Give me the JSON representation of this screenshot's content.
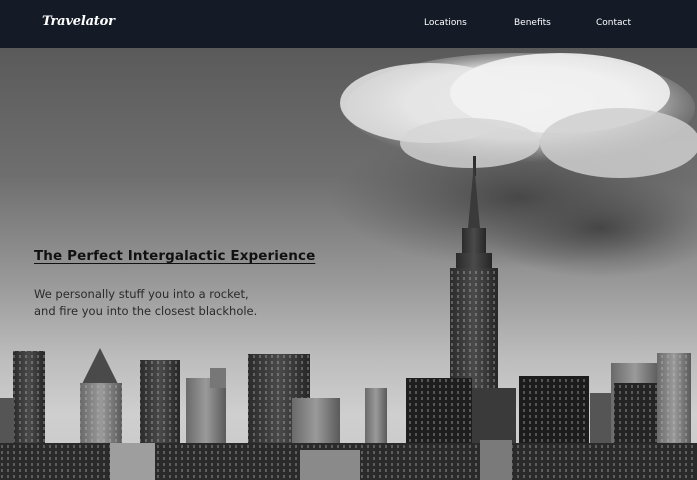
{
  "brand": {
    "logo": "Travelator"
  },
  "nav": {
    "items": [
      {
        "label": "Locations"
      },
      {
        "label": "Benefits"
      },
      {
        "label": "Contact"
      }
    ]
  },
  "hero": {
    "title": "The Perfect Intergalactic Experience",
    "subtitle_line1": "We personally stuff you into a rocket,",
    "subtitle_line2": "and fire you into the closest blackhole.",
    "image": "black-and-white-city-skyline-photo"
  },
  "colors": {
    "navbar_bg": "#141b27",
    "nav_text": "#ffffff",
    "hero_text": "#111111"
  }
}
